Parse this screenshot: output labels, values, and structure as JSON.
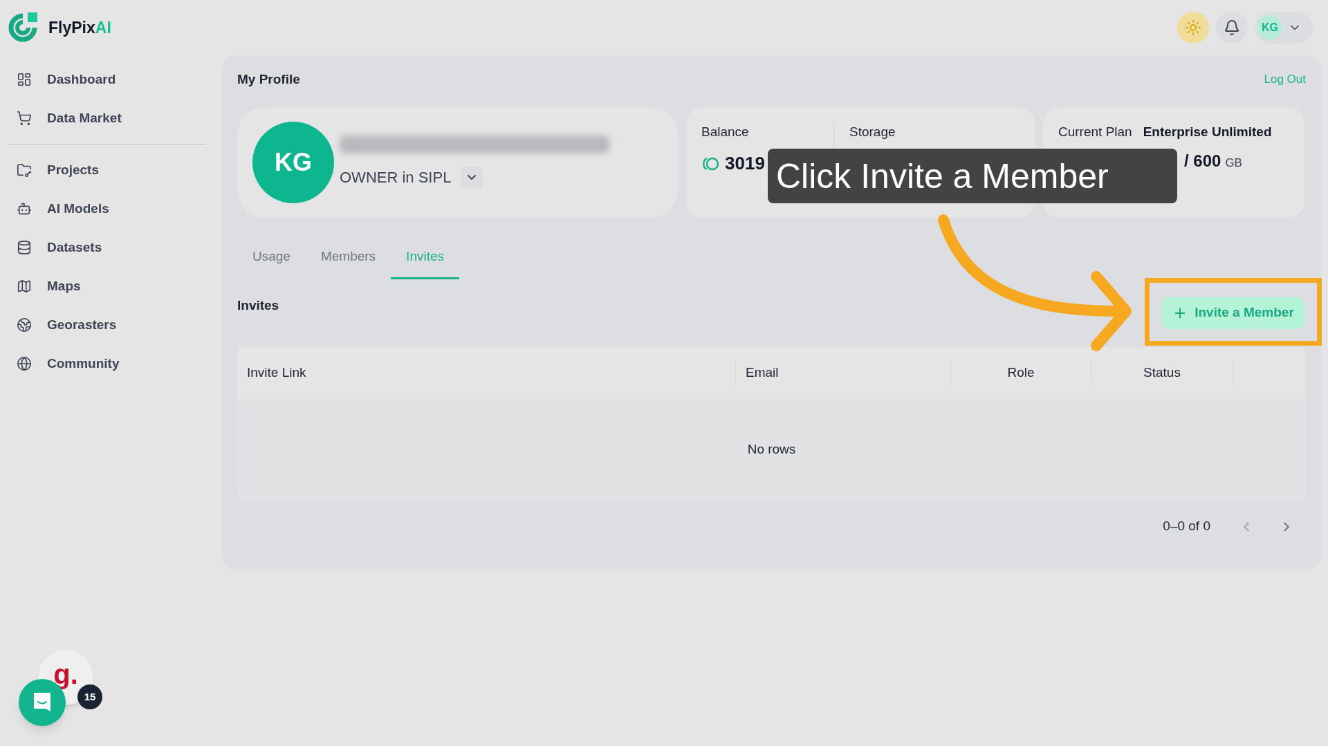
{
  "app": {
    "name_main": "FlyPix",
    "name_accent": "AI"
  },
  "header": {
    "avatar_initials": "KG"
  },
  "sidebar": {
    "groups": [
      [
        {
          "label": "Dashboard"
        },
        {
          "label": "Data Market"
        }
      ],
      [
        {
          "label": "Projects"
        },
        {
          "label": "AI Models"
        },
        {
          "label": "Datasets"
        },
        {
          "label": "Maps"
        },
        {
          "label": "Georasters"
        },
        {
          "label": "Community"
        }
      ]
    ]
  },
  "profile": {
    "title": "My Profile",
    "logout": "Log Out",
    "initials": "KG",
    "role": "OWNER in SIPL"
  },
  "balance": {
    "label": "Balance",
    "value": "3019"
  },
  "storage": {
    "label": "Storage"
  },
  "plan": {
    "label": "Current Plan",
    "name": "Enterprise Unlimited",
    "storage_total": "/ 600",
    "storage_unit": "GB"
  },
  "tabs": [
    {
      "label": "Usage",
      "selected": false
    },
    {
      "label": "Members",
      "selected": false
    },
    {
      "label": "Invites",
      "selected": true
    }
  ],
  "invites": {
    "heading": "Invites",
    "button": "Invite a Member",
    "columns": [
      "Invite Link",
      "Email",
      "Role",
      "Status"
    ],
    "empty": "No rows",
    "range": "0–0 of 0"
  },
  "callout": {
    "text": "Click Invite a Member"
  },
  "chat_widget": {
    "logo_letter": "g.",
    "badge": "15"
  }
}
